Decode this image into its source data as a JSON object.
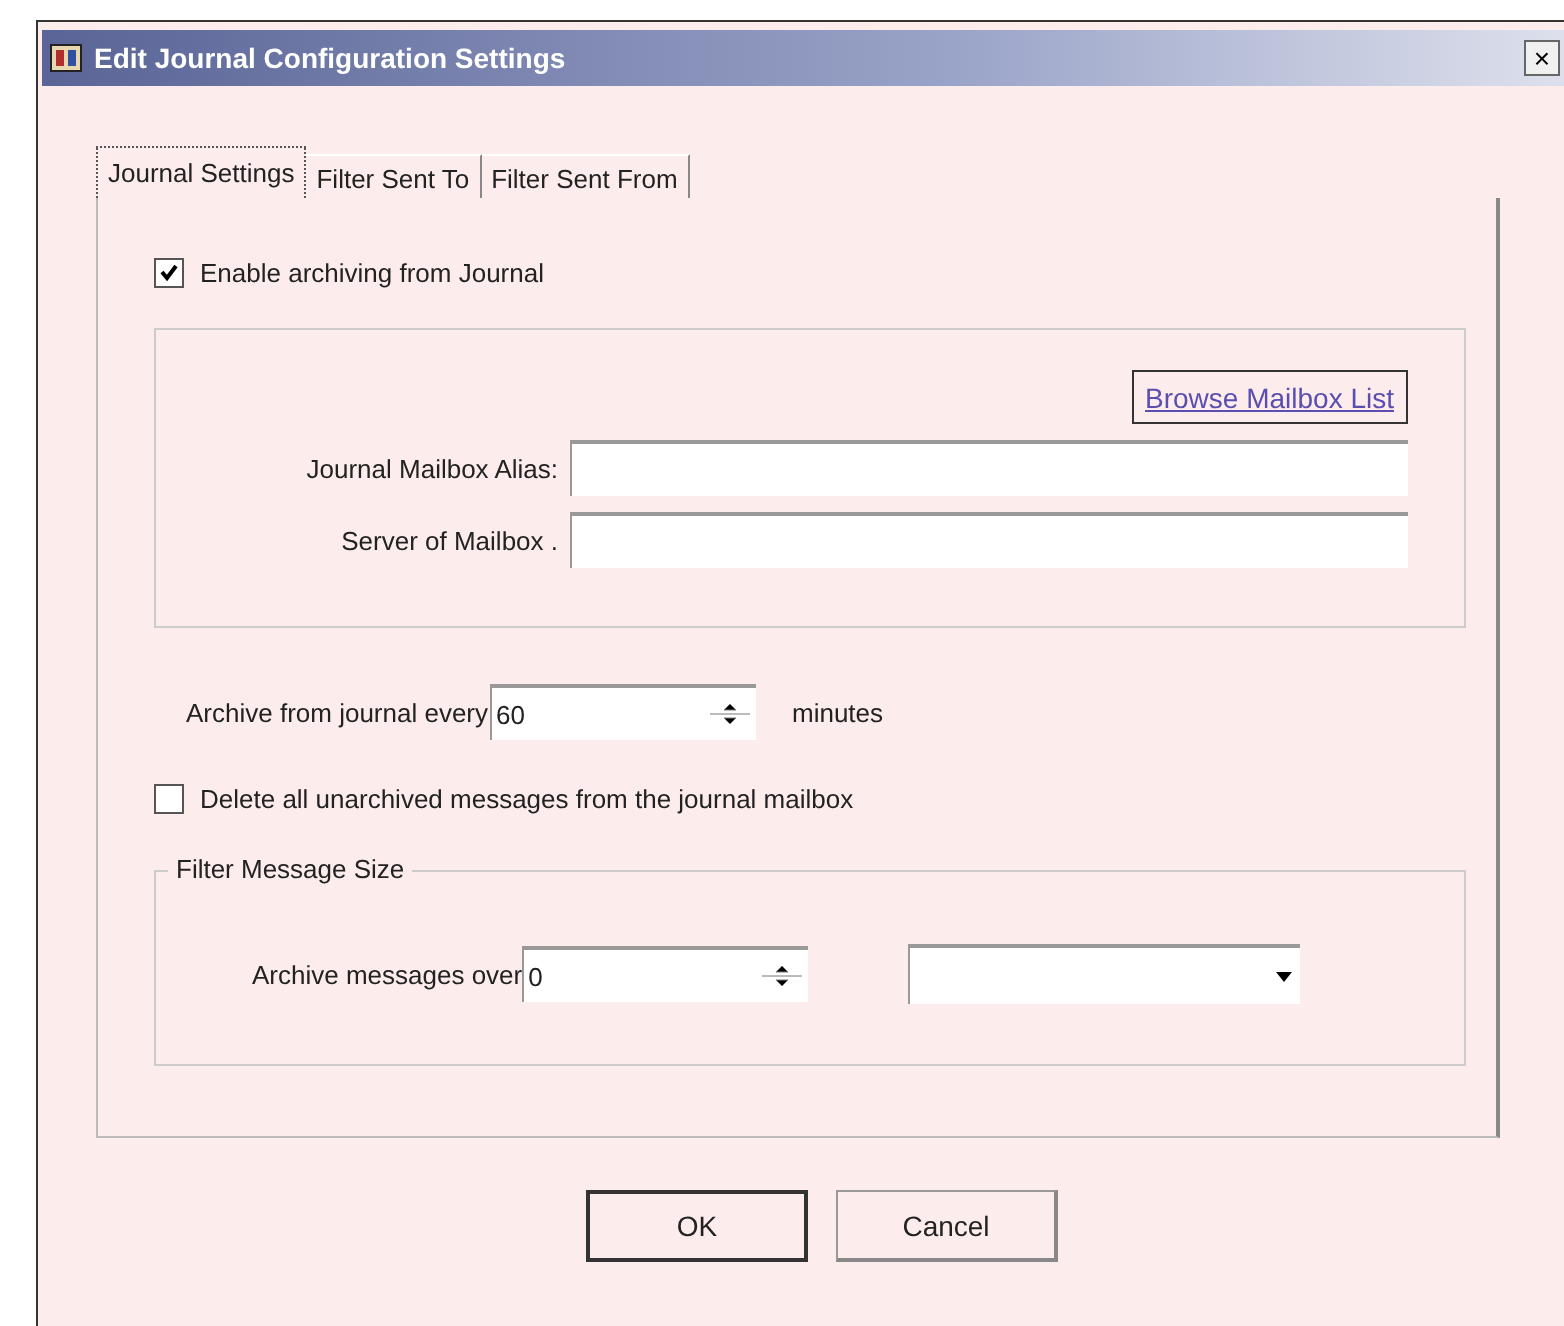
{
  "window": {
    "title": "Edit Journal Configuration Settings",
    "close": "×"
  },
  "tabs": [
    {
      "label": "Journal Settings",
      "selected": true
    },
    {
      "label": "Filter Sent To",
      "selected": false
    },
    {
      "label": "Filter Sent From",
      "selected": false
    }
  ],
  "enable_archiving": {
    "label": "Enable archiving from Journal",
    "checked": true
  },
  "mailbox_group": {
    "browse_button": "Browse Mailbox List",
    "fields": [
      {
        "label": "Journal Mailbox Alias:"
      },
      {
        "label": "Server of Mailbox ."
      }
    ]
  },
  "archive_interval": {
    "label": "Archive from journal every",
    "value": "60",
    "unit": "minutes"
  },
  "delete_unarchived": {
    "label": "Delete all unarchived messages from the journal mailbox",
    "checked": false
  },
  "size_filter": {
    "title": "Filter Message Size",
    "label": "Archive messages over",
    "value": "0"
  },
  "buttons": [
    {
      "label": "OK",
      "default": true
    },
    {
      "label": "Cancel",
      "default": false
    }
  ]
}
